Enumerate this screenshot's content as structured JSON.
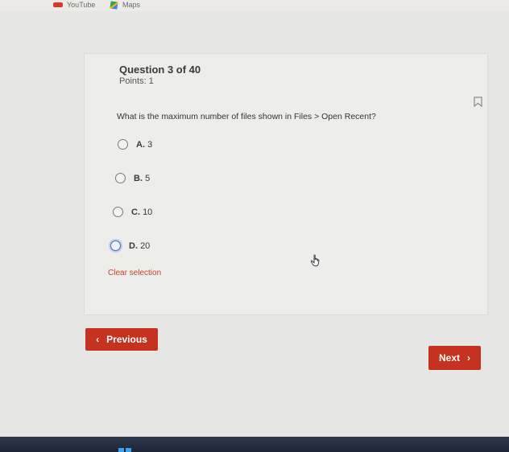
{
  "bookmarks": [
    {
      "label": "YouTube",
      "icon": "youtube-icon"
    },
    {
      "label": "Maps",
      "icon": "maps-icon"
    }
  ],
  "question": {
    "title": "Question 3 of 40",
    "points": "Points: 1",
    "text": "What is the maximum number of files shown in Files > Open Recent?",
    "options": [
      {
        "letter": "A.",
        "value": "3"
      },
      {
        "letter": "B.",
        "value": "5"
      },
      {
        "letter": "C.",
        "value": "10"
      },
      {
        "letter": "D.",
        "value": "20"
      }
    ],
    "clear_label": "Clear selection"
  },
  "nav": {
    "previous_label": "Previous",
    "next_label": "Next"
  },
  "colors": {
    "accent": "#c5321f",
    "link": "#c4432e",
    "focus": "#3d6ec9"
  }
}
